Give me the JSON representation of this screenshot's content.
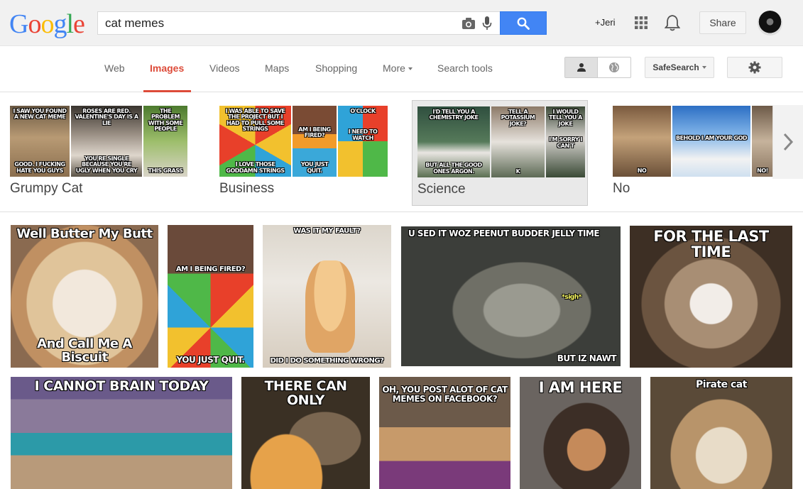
{
  "header": {
    "logo_letters": [
      {
        "ch": "G",
        "color": "#4285f4"
      },
      {
        "ch": "o",
        "color": "#ea4335"
      },
      {
        "ch": "o",
        "color": "#fbbc05"
      },
      {
        "ch": "g",
        "color": "#4285f4"
      },
      {
        "ch": "l",
        "color": "#34a853"
      },
      {
        "ch": "e",
        "color": "#ea4335"
      }
    ],
    "search_value": "cat memes",
    "user_label": "+Jeri",
    "share_label": "Share"
  },
  "nav": {
    "items": [
      {
        "label": "Web",
        "active": false
      },
      {
        "label": "Images",
        "active": true
      },
      {
        "label": "Videos",
        "active": false
      },
      {
        "label": "Maps",
        "active": false
      },
      {
        "label": "Shopping",
        "active": false
      },
      {
        "label": "More",
        "active": false
      },
      {
        "label": "Search tools",
        "active": false
      }
    ],
    "safesearch_label": "SafeSearch"
  },
  "categories": [
    {
      "label": "Grumpy Cat",
      "selected": false
    },
    {
      "label": "Business",
      "selected": false
    },
    {
      "label": "Science",
      "selected": true
    },
    {
      "label": "No",
      "selected": false
    }
  ],
  "category_thumbs": {
    "grumpy": [
      {
        "top": "I SAW YOU FOUND A NEW CAT MEME",
        "bottom": "GOOD. I FUCKING HATE YOU GUYS"
      },
      {
        "top": "ROSES ARE RED. VALENTINE'S DAY IS A LIE",
        "bottom": "YOU'RE SINGLE BECAUSE YOU'RE UGLY WHEN YOU CRY"
      },
      {
        "top": "THE PROBLEM WITH SOME PEOPLE",
        "bottom": "THIS GRASS"
      }
    ],
    "business": [
      {
        "top": "I WAS ABLE TO SAVE THE PROJECT BUT I HAD TO PULL SOME STRINGS",
        "bottom": "I LOVE THOSE GODDAMN STRINGS"
      },
      {
        "top": "AM I BEING FIRED?",
        "bottom": "YOU JUST QUIT."
      },
      {
        "top": "O'CLOCK",
        "bottom": "I NEED TO WATCH"
      }
    ],
    "science": [
      {
        "top": "I'D TELL YOU A CHEMISTRY JOKE",
        "bottom": "BUT ALL THE GOOD ONES ARGON."
      },
      {
        "top": "TELL A POTASSIUM JOKE?",
        "bottom": "K"
      },
      {
        "top": "I WOULD TELL YOU A JOKE",
        "bottom": "I'M SORRY I CAN'T"
      }
    ],
    "no": [
      {
        "top": "",
        "bottom": "NO"
      },
      {
        "top": "",
        "bottom": "BEHOLD I AM YOUR GOD"
      },
      {
        "top": "",
        "bottom": "NO!"
      }
    ]
  },
  "results_row1": [
    {
      "top": "Well Butter My Butt",
      "bottom": "And Call Me A Biscuit"
    },
    {
      "top": "AM I BEING FIRED?",
      "bottom": "YOU JUST QUIT."
    },
    {
      "top": "WAS IT MY FAULT?",
      "bottom": "DID I DO SOMETHING WRONG?"
    },
    {
      "top": "U SED IT WOZ PEENUT BUDDER JELLY TIME",
      "bottom": "BUT IZ NAWT",
      "middle": "*sigh*"
    },
    {
      "top": "FOR THE LAST TIME",
      "bottom": ""
    }
  ],
  "results_row2": [
    {
      "top": "I CANNOT BRAIN TODAY",
      "bottom": ""
    },
    {
      "top": "THERE CAN ONLY",
      "bottom": ""
    },
    {
      "top": "OH, YOU POST ALOT OF CAT MEMES ON FACEBOOK?",
      "bottom": ""
    },
    {
      "top": "I AM HERE",
      "bottom": ""
    },
    {
      "top": "Pirate cat",
      "bottom": ""
    }
  ],
  "colors": {
    "accent_red": "#dd4b39",
    "search_blue": "#4285f4"
  }
}
